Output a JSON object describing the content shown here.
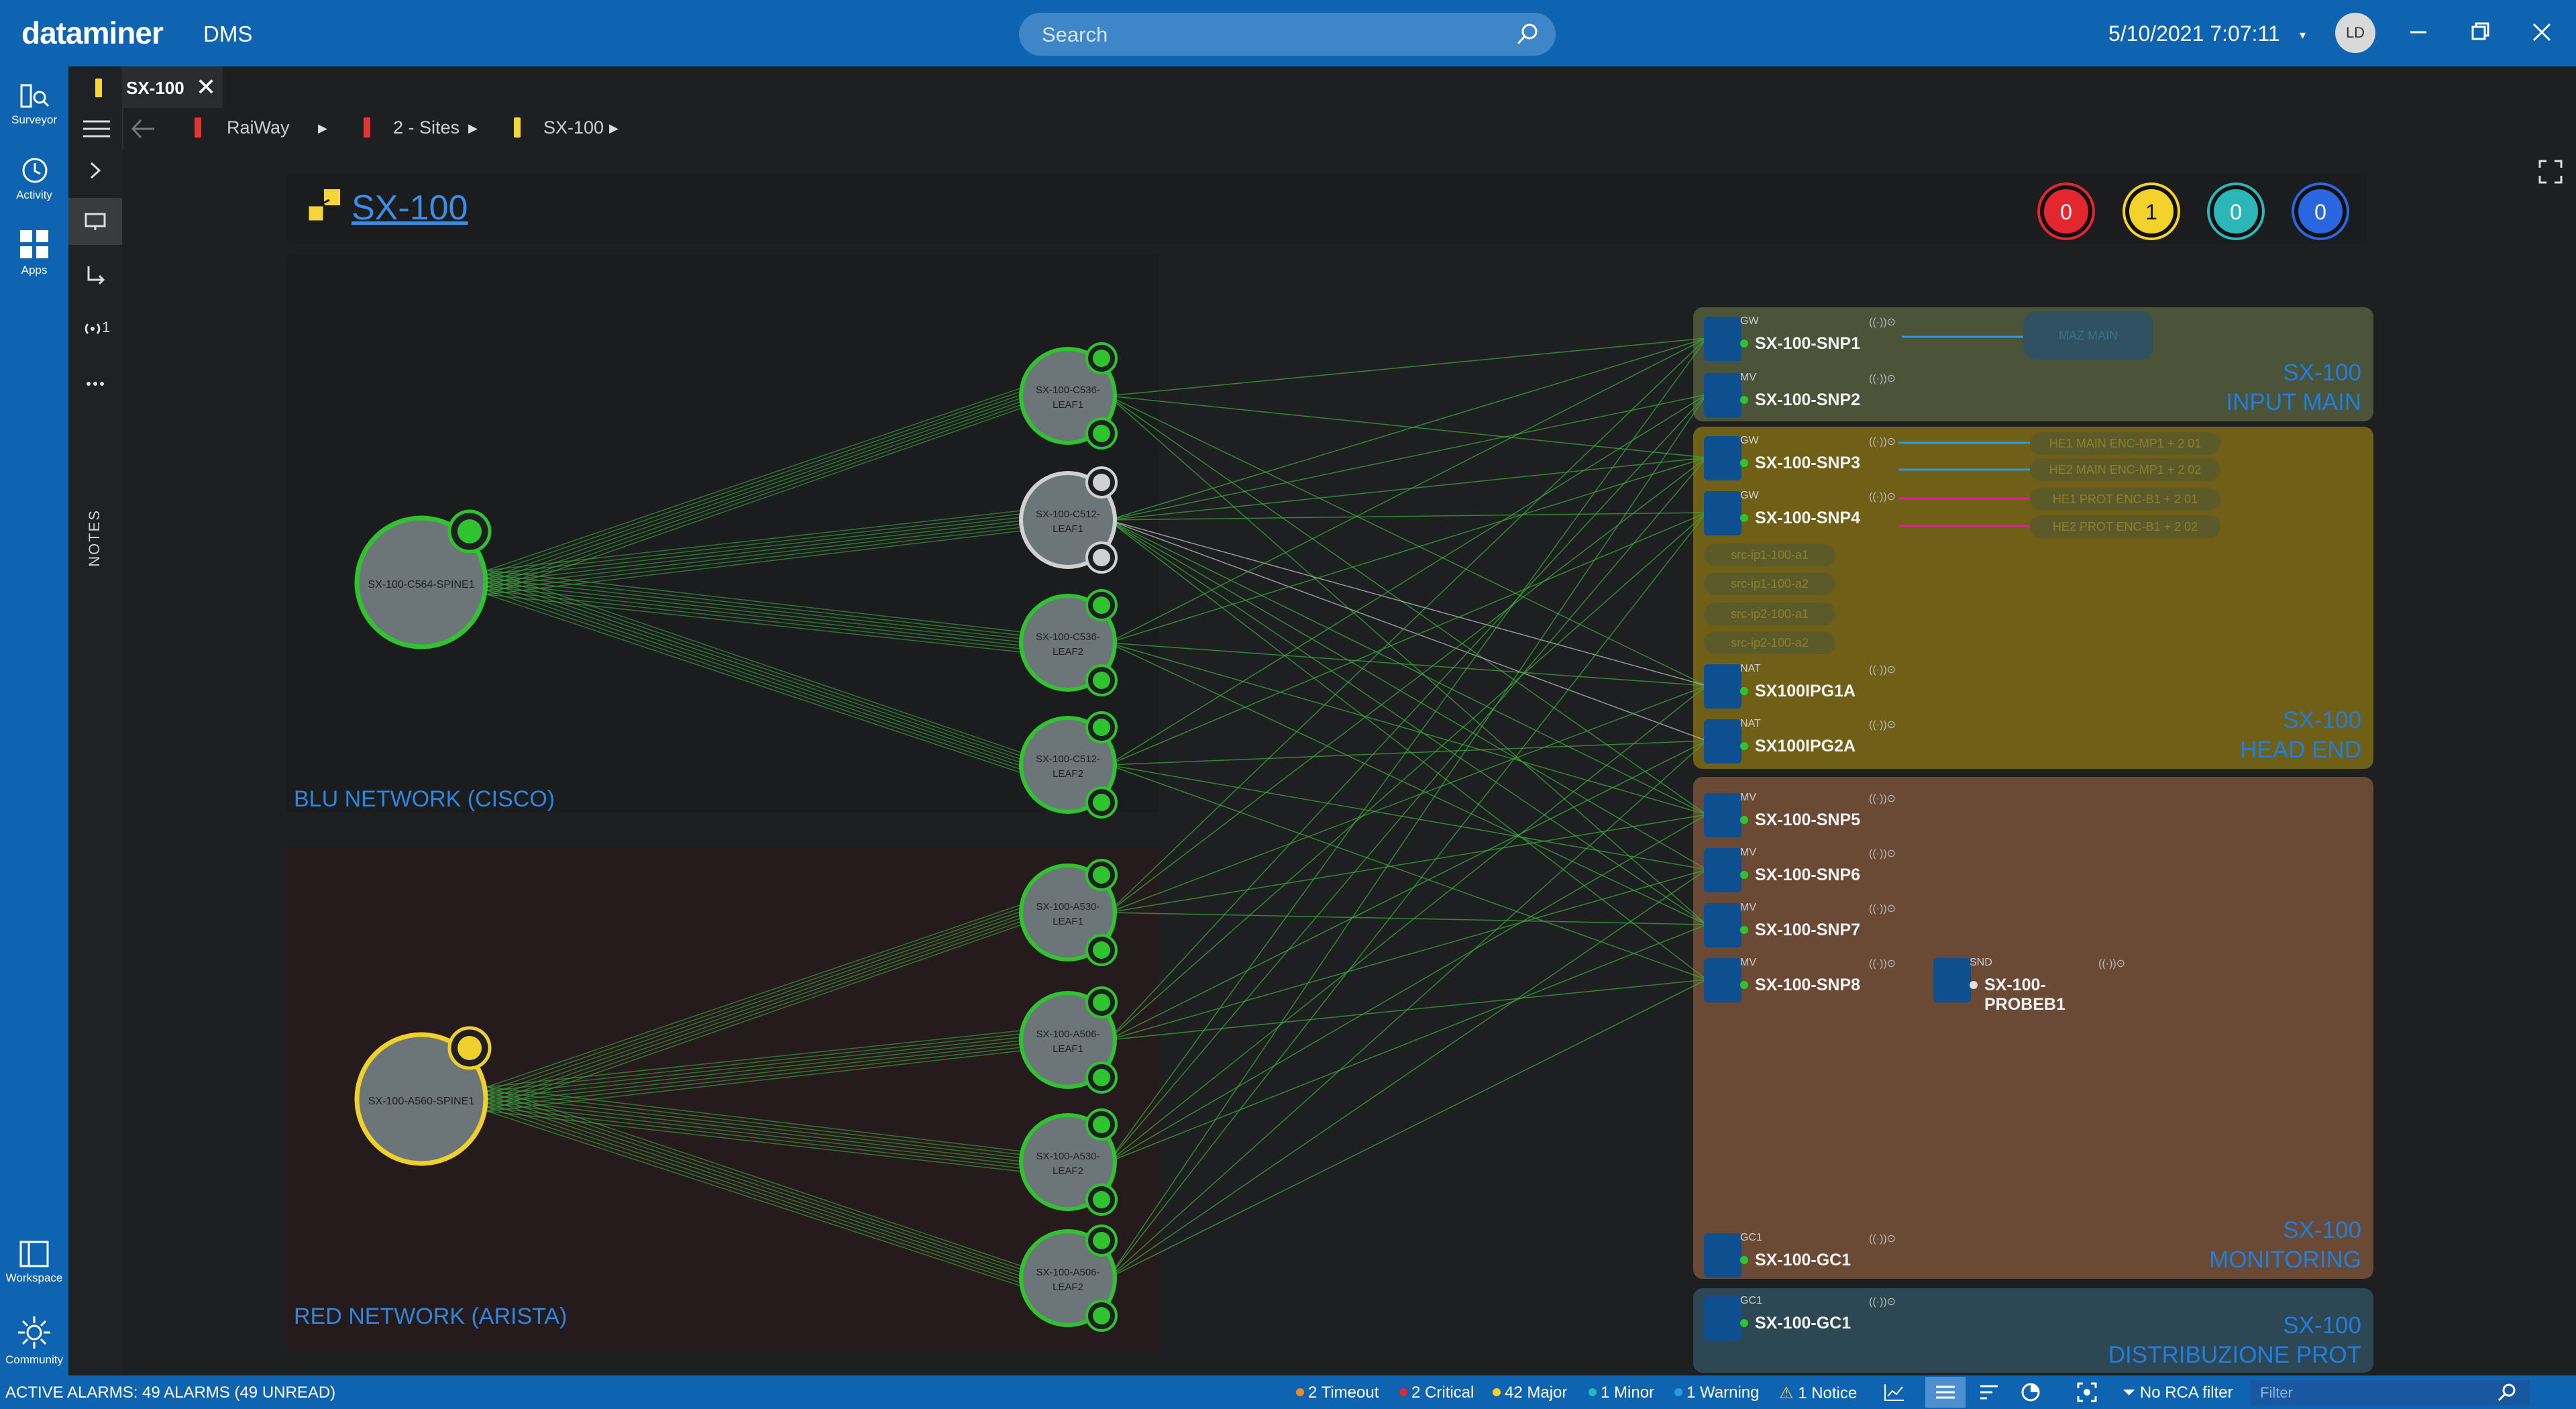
{
  "app": {
    "logo": "dataminer",
    "product": "DMS"
  },
  "topbar": {
    "search_placeholder": "Search",
    "datetime": "5/10/2021 7:07:11",
    "user_initials": "LD"
  },
  "rail": {
    "items": [
      {
        "label": "Surveyor"
      },
      {
        "label": "Activity"
      },
      {
        "label": "Apps"
      }
    ],
    "bottom": [
      {
        "label": "Workspace"
      },
      {
        "label": "Community"
      }
    ]
  },
  "sidebar2": {
    "notes_label": "NOTES",
    "subscriptions_count": "1"
  },
  "tab": {
    "label": "SX-100",
    "color": "#f4d63b"
  },
  "breadcrumb": {
    "items": [
      {
        "label": "RaiWay",
        "color": "#e2353a"
      },
      {
        "label": "2 - Sites",
        "color": "#e2353a"
      },
      {
        "label": "SX-100",
        "color": "#f4d63b"
      }
    ]
  },
  "view": {
    "title": "SX-100",
    "alarm_counters": [
      {
        "value": "0",
        "color": "#e4262f"
      },
      {
        "value": "1",
        "color": "#f4d22c"
      },
      {
        "value": "0",
        "color": "#2bb7b7"
      },
      {
        "value": "0",
        "color": "#2a66e0"
      }
    ]
  },
  "networks": {
    "blu": {
      "label": "BLU NETWORK (CISCO)",
      "spine": {
        "label": "SX-100-C564-SPINE1",
        "status": "#2fc42f"
      },
      "leaves": [
        {
          "label1": "SX-100-C536-",
          "label2": "LEAF1",
          "status": "#2fc42f"
        },
        {
          "label1": "SX-100-C512-",
          "label2": "LEAF1",
          "status": "#d0d0d0"
        },
        {
          "label1": "SX-100-C536-",
          "label2": "LEAF2",
          "status": "#2fc42f"
        },
        {
          "label1": "SX-100-C512-",
          "label2": "LEAF2",
          "status": "#2fc42f"
        }
      ]
    },
    "red": {
      "label": "RED NETWORK (ARISTA)",
      "spine": {
        "label": "SX-100-A560-SPINE1",
        "status": "#f0d02a"
      },
      "leaves": [
        {
          "label1": "SX-100-A530-",
          "label2": "LEAF1",
          "status": "#2fc42f"
        },
        {
          "label1": "SX-100-A506-",
          "label2": "LEAF1",
          "status": "#2fc42f"
        },
        {
          "label1": "SX-100-A530-",
          "label2": "LEAF2",
          "status": "#2fc42f"
        },
        {
          "label1": "SX-100-A506-",
          "label2": "LEAF2",
          "status": "#2fc42f"
        }
      ]
    }
  },
  "panels": {
    "input_main": {
      "title1": "SX-100",
      "title2": "INPUT MAIN"
    },
    "head_end": {
      "title1": "SX-100",
      "title2": "HEAD END"
    },
    "monitoring": {
      "title1": "SX-100",
      "title2": "MONITORING"
    },
    "distribuzione": {
      "title1": "SX-100",
      "title2": "DISTRIBUZIONE PROT"
    }
  },
  "elements": [
    {
      "type": "GW",
      "name": "SX-100-SNP1",
      "status": "#2fc42f"
    },
    {
      "type": "MV",
      "name": "SX-100-SNP2",
      "status": "#2fc42f"
    },
    {
      "type": "GW",
      "name": "SX-100-SNP3",
      "status": "#2fc42f"
    },
    {
      "type": "GW",
      "name": "SX-100-SNP4",
      "status": "#2fc42f"
    },
    {
      "type": "NAT",
      "name": "SX100IPG1A",
      "status": "#2fc42f"
    },
    {
      "type": "NAT",
      "name": "SX100IPG2A",
      "status": "#2fc42f"
    },
    {
      "type": "MV",
      "name": "SX-100-SNP5",
      "status": "#2fc42f"
    },
    {
      "type": "MV",
      "name": "SX-100-SNP6",
      "status": "#2fc42f"
    },
    {
      "type": "MV",
      "name": "SX-100-SNP7",
      "status": "#2fc42f"
    },
    {
      "type": "MV",
      "name": "SX-100-SNP8",
      "status": "#2fc42f"
    },
    {
      "type": "SND",
      "name": "SX-100-PROBEB1",
      "status": "#e0e0e0"
    },
    {
      "type": "GC1",
      "name": "SX-100-GC1",
      "status": "#2fc42f"
    },
    {
      "type": "GC1",
      "name": "SX-100-GC1",
      "status": "#2fc42f"
    }
  ],
  "pills": {
    "input_main": "MAZ MAIN",
    "head_end_services": [
      "HE1 MAIN ENC-MP1 + 2 01",
      "HE2 MAIN ENC-MP1 + 2 02",
      "HE1 PROT ENC-B1 + 2 01",
      "HE2 PROT ENC-B1 + 2 02"
    ],
    "head_end_sources": [
      "src-ip1-100-a1",
      "src-ip1-100-a2",
      "src-ip2-100-a1",
      "src-ip2-100-a2"
    ]
  },
  "statusbar": {
    "active_alarms": "ACTIVE ALARMS: 49 ALARMS (49 UNREAD)",
    "timeout": "2 Timeout",
    "critical": "2 Critical",
    "major": "42 Major",
    "minor": "1 Minor",
    "warning": "1 Warning",
    "notice": "1 Notice",
    "rca": "No RCA filter",
    "filter_placeholder": "Filter"
  },
  "colors": {
    "brand_blue": "#0e64b0",
    "timeout": "#f08a24",
    "critical": "#e4262f",
    "major": "#f4d22c",
    "minor": "#2bb7b7",
    "warning": "#2a9de0",
    "notice": "#f4d22c",
    "link_green": "#3cc43c"
  }
}
